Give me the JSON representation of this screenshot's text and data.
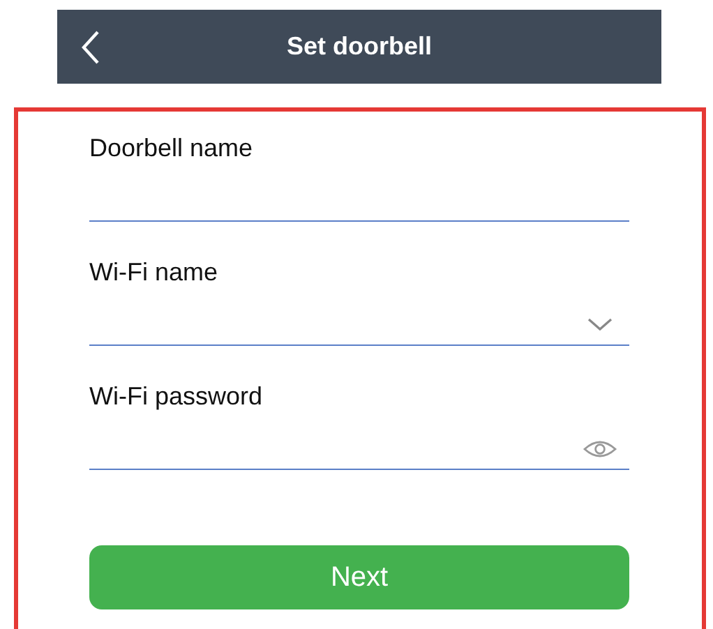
{
  "header": {
    "title": "Set doorbell"
  },
  "fields": [
    {
      "label": "Doorbell name",
      "kind": "text"
    },
    {
      "label": "Wi-Fi name",
      "kind": "select"
    },
    {
      "label": "Wi-Fi password",
      "kind": "password"
    }
  ],
  "button": "Next"
}
